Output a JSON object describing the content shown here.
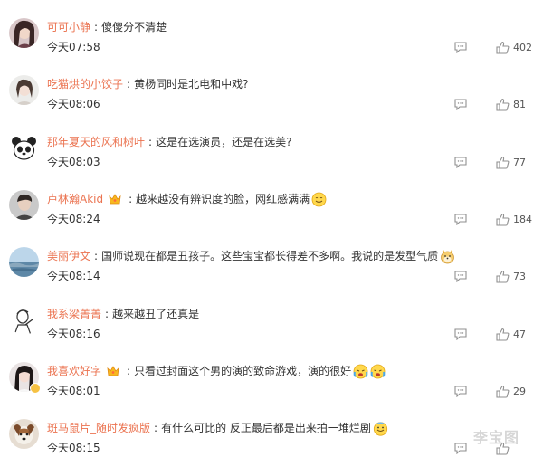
{
  "comments": [
    {
      "username": "可可小静",
      "text": "傻傻分不清楚",
      "time": "今天07:58",
      "likes": "402",
      "avatar": "woman-portrait",
      "crown": false,
      "vbadge": false
    },
    {
      "username": "吃猫烘的小饺子",
      "text": "黄杨同时是北电和中戏?",
      "time": "今天08:06",
      "likes": "81",
      "avatar": "woman-light-portrait",
      "crown": false,
      "vbadge": false
    },
    {
      "username": "那年夏天的风和树叶",
      "text": "这是在选演员，还是在选美?",
      "time": "今天08:03",
      "likes": "77",
      "avatar": "panda-cartoon",
      "crown": false,
      "vbadge": false
    },
    {
      "username": "卢林瀚Akid",
      "text": "越来越没有辨识度的脸，网红感满满",
      "time": "今天08:24",
      "likes": "184",
      "avatar": "man-portrait",
      "crown": true,
      "vbadge": false,
      "emojis": [
        "smile-emoji"
      ]
    },
    {
      "username": "美丽伊文",
      "text": "国师说现在都是丑孩子。这些宝宝都长得差不多啊。我说的是发型气质",
      "time": "今天08:14",
      "likes": "73",
      "avatar": "seaside-landscape",
      "crown": false,
      "vbadge": false,
      "emojis": [
        "doge-emoji"
      ]
    },
    {
      "username": "我系梁菁菁",
      "text": "越来越丑了还真是",
      "time": "今天08:16",
      "likes": "47",
      "avatar": "sketch-portrait",
      "crown": false,
      "vbadge": false
    },
    {
      "username": "我喜欢好字",
      "text": "只看过封面这个男的演的致命游戏，演的很好",
      "time": "今天08:01",
      "likes": "29",
      "avatar": "woman-dark-hair",
      "crown": true,
      "vbadge": true,
      "emojis": [
        "crying-emoji",
        "crying-emoji"
      ]
    },
    {
      "username": "斑马鼠片_随时发疯版",
      "text": "有什么可比的 反正最后都是出来拍一堆烂剧",
      "time": "今天08:15",
      "likes": "",
      "avatar": "dog-portrait",
      "crown": false,
      "vbadge": false,
      "emojis": [
        "sweat-emoji"
      ]
    }
  ],
  "watermark": "李宝图",
  "colors": {
    "username": "#eb7350",
    "text": "#333333",
    "icon": "#999999"
  }
}
